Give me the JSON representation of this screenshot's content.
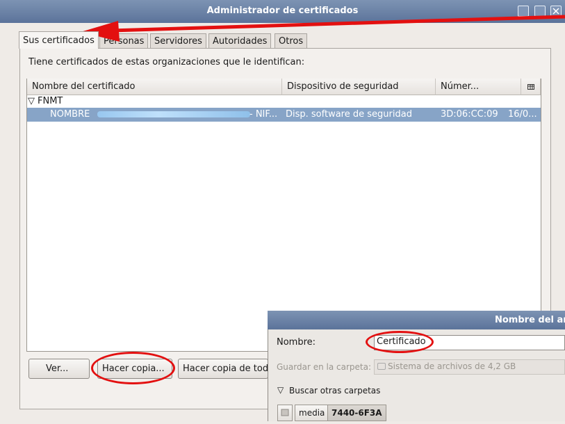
{
  "window": {
    "title": "Administrador de certificados",
    "controls": [
      "minimize-icon",
      "maximize-icon",
      "close-icon"
    ]
  },
  "tabs": [
    {
      "label": "Sus certificados",
      "active": true
    },
    {
      "label": "Personas",
      "active": false
    },
    {
      "label": "Servidores",
      "active": false
    },
    {
      "label": "Autoridades",
      "active": false
    },
    {
      "label": "Otros",
      "active": false
    }
  ],
  "panel": {
    "description": "Tiene certificados de estas organizaciones que le identifican:"
  },
  "table": {
    "columns": [
      "Nombre del certificado",
      "Dispositivo de seguridad",
      "Númer...",
      "column-picker-icon"
    ],
    "group": {
      "expander": "▽",
      "label": "FNMT"
    },
    "rows": [
      {
        "name_prefix": "NOMBRE",
        "name_suffix": "- NIF...",
        "device": "Disp. software de seguridad",
        "serial": "3D:06:CC:09",
        "expires": "16/0...",
        "selected": true
      }
    ]
  },
  "buttons": {
    "view": "Ver...",
    "backup": "Hacer copia...",
    "backup_all": "Hacer copia de tod"
  },
  "save_dialog": {
    "title": "Nombre del arch",
    "name_label": "Nombre:",
    "name_value": "Certificado",
    "folder_label": "Guardar en la carpeta:",
    "folder_value": "Sistema de archivos de 4,2 GB",
    "browse_toggle": "▽",
    "browse_label": "Buscar otras carpetas",
    "path": [
      "media",
      "7440-6F3A"
    ]
  },
  "annotations": {
    "color": "#e31010"
  }
}
